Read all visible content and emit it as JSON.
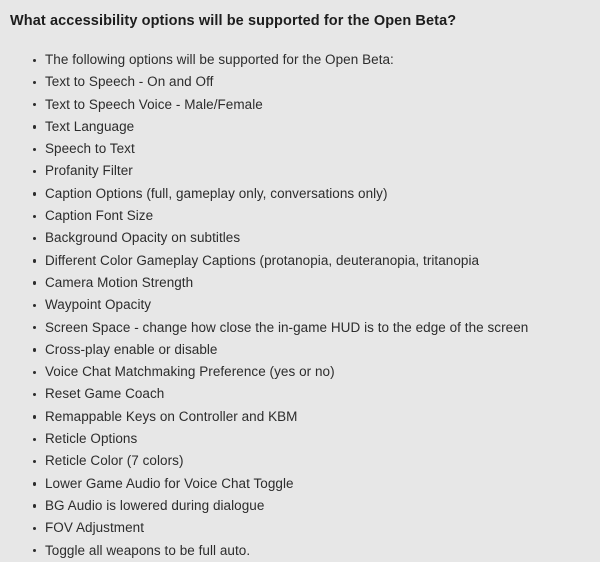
{
  "page": {
    "background_color": "#e7e7e7",
    "text_color": "#2c2c2c",
    "heading_color": "#1d1d1d"
  },
  "heading": {
    "text": "What accessibility options will be supported for the Open Beta?"
  },
  "list": {
    "bullet_glyph": "•",
    "items": [
      {
        "label": "The following options will be supported for the Open Beta:"
      },
      {
        "label": "Text to Speech - On and Off"
      },
      {
        "label": "Text to Speech Voice - Male/Female"
      },
      {
        "label": "Text Language"
      },
      {
        "label": "Speech to Text"
      },
      {
        "label": "Profanity Filter"
      },
      {
        "label": "Caption Options (full, gameplay only, conversations only)"
      },
      {
        "label": "Caption Font Size"
      },
      {
        "label": "Background Opacity on subtitles"
      },
      {
        "label": "Different Color Gameplay Captions (protanopia, deuteranopia, tritanopia"
      },
      {
        "label": "Camera Motion Strength"
      },
      {
        "label": "Waypoint Opacity"
      },
      {
        "label": "Screen Space - change how close the in-game HUD is to the edge of the screen"
      },
      {
        "label": "Cross-play enable or disable"
      },
      {
        "label": "Voice Chat Matchmaking Preference (yes or no)"
      },
      {
        "label": "Reset Game Coach"
      },
      {
        "label": "Remappable Keys on Controller and KBM"
      },
      {
        "label": "Reticle Options"
      },
      {
        "label": "Reticle Color (7 colors)"
      },
      {
        "label": "Lower Game Audio for Voice Chat Toggle"
      },
      {
        "label": "BG Audio is lowered during dialogue"
      },
      {
        "label": "FOV Adjustment"
      },
      {
        "label": "Toggle all weapons to be full auto."
      }
    ]
  }
}
